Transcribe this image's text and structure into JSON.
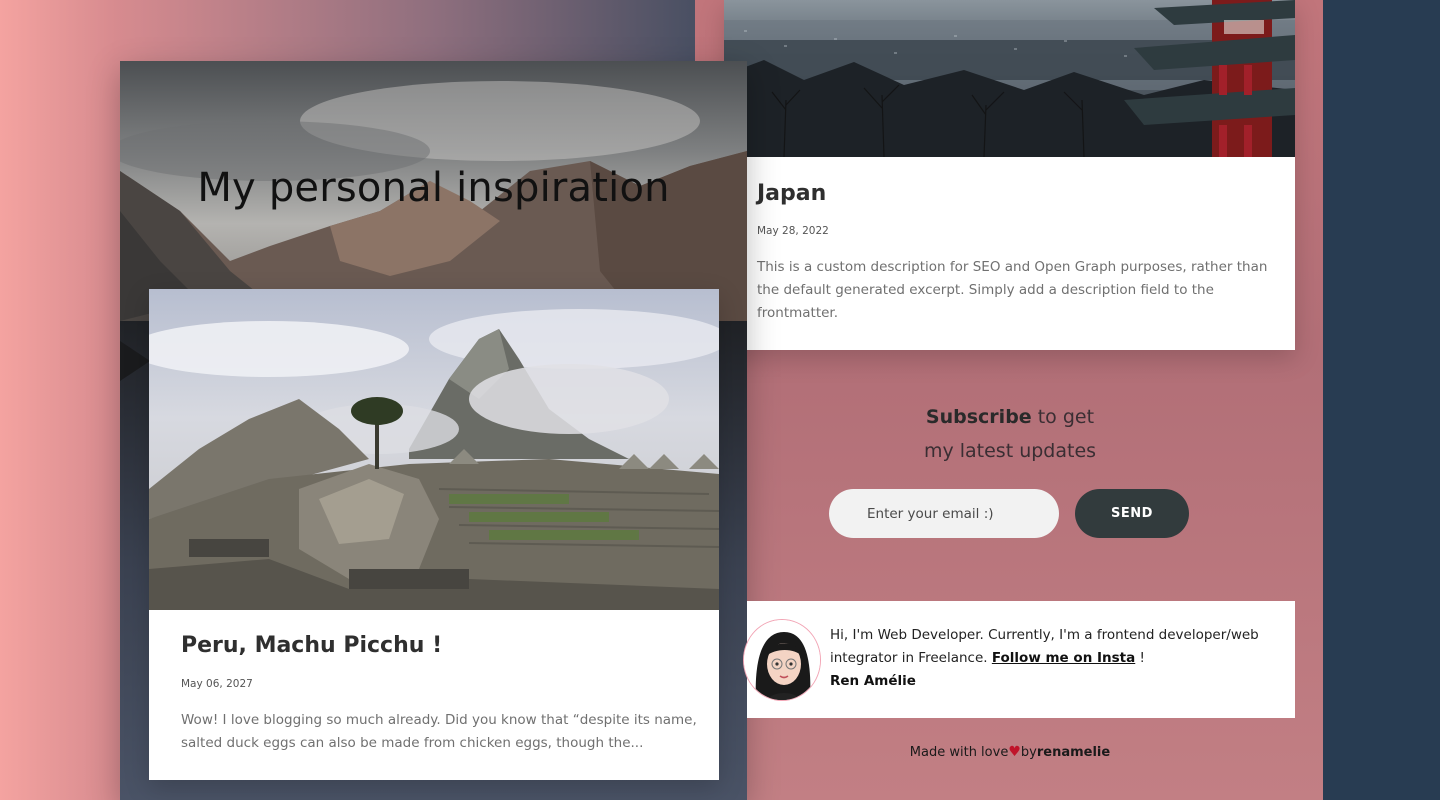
{
  "hero": {
    "title": "My personal inspiration"
  },
  "posts": [
    {
      "title": "Peru, Machu Picchu !",
      "date": "May 06, 2027",
      "excerpt": "Wow! I love blogging so much already. Did you know that “despite its name, salted duck eggs can also be made from chicken eggs, though the..."
    },
    {
      "title": "Japan",
      "date": "May 28, 2022",
      "excerpt": "This is a custom description for SEO and Open Graph purposes, rather than the default generated excerpt. Simply add a description field to the frontmatter."
    }
  ],
  "subscribe": {
    "bold": "Subscribe",
    "rest_line1": "to get",
    "line2": "my latest updates",
    "placeholder": "Enter your email :)",
    "button": "SEND"
  },
  "author": {
    "intro": "Hi, I'm Web Developer. Currently, I'm a frontend developer/web integrator in Freelance.",
    "link": "Follow me on Insta",
    "suffix": "!",
    "name": "Ren Amélie"
  },
  "footer": {
    "made_with": "Made with love",
    "by": "by",
    "handle": "renamelie"
  },
  "colors": {
    "send_button": "#323b3d",
    "heart": "#c0142a",
    "side_panel": "#283c52"
  }
}
